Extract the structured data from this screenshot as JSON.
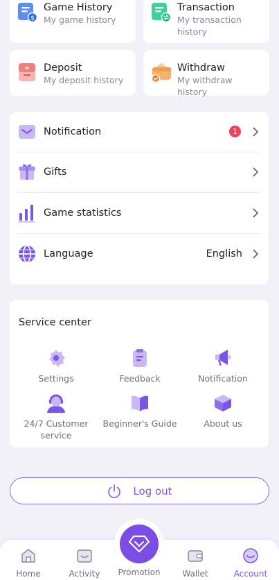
{
  "history": {
    "game": {
      "title": "Game History",
      "subtitle": "My game history"
    },
    "transaction": {
      "title": "Transaction",
      "subtitle_line1": "My transaction",
      "subtitle_line2": "history"
    },
    "deposit": {
      "title": "Deposit",
      "subtitle": "My deposit history"
    },
    "withdraw": {
      "title": "Withdraw",
      "subtitle": "My withdraw history"
    }
  },
  "menu": {
    "notification": {
      "label": "Notification",
      "badge": "1"
    },
    "gifts": {
      "label": "Gifts"
    },
    "game_statistics": {
      "label": "Game statistics"
    },
    "language": {
      "label": "Language",
      "value": "English"
    }
  },
  "service": {
    "title": "Service center",
    "items": [
      {
        "label": "Settings",
        "icon": "gear-icon"
      },
      {
        "label": "Feedback",
        "icon": "clipboard-icon"
      },
      {
        "label": "Notification",
        "icon": "megaphone-icon"
      },
      {
        "label_line1": "24/7 Customer",
        "label_line2": "service",
        "icon": "support-agent-icon"
      },
      {
        "label": "Beginner's Guide",
        "icon": "book-icon"
      },
      {
        "label": "About us",
        "icon": "cube-icon"
      }
    ]
  },
  "logout": {
    "label": "Log out"
  },
  "nav": {
    "home": "Home",
    "activity": "Activity",
    "promotion": "Promotion",
    "wallet": "Wallet",
    "account": "Account"
  },
  "colors": {
    "accent": "#7a55e8",
    "background": "#f2f1f9",
    "badge": "#f0435a"
  }
}
